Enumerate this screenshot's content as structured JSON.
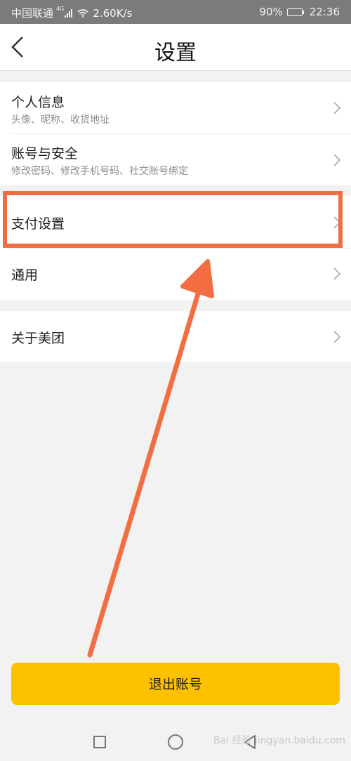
{
  "status_bar": {
    "carrier": "中国联通",
    "network": "4G",
    "speed": "2.60K/s",
    "battery": "90%",
    "time": "22:36"
  },
  "header": {
    "title": "设置",
    "back_icon": "chevron-left-icon"
  },
  "groups": [
    {
      "items": [
        {
          "label": "个人信息",
          "sub": "头像、昵称、收货地址"
        },
        {
          "label": "账号与安全",
          "sub": "修改密码、修改手机号码、社交账号绑定"
        }
      ]
    },
    {
      "items": [
        {
          "label": "支付设置"
        },
        {
          "label": "通用"
        }
      ]
    },
    {
      "items": [
        {
          "label": "关于美团"
        }
      ]
    }
  ],
  "logout_label": "退出账号",
  "watermark": "Bai 经验 jingyan.baidu.com",
  "colors": {
    "accent": "#fdc100",
    "highlight": "#f26e42",
    "status_bar": "#7b7b7b"
  }
}
